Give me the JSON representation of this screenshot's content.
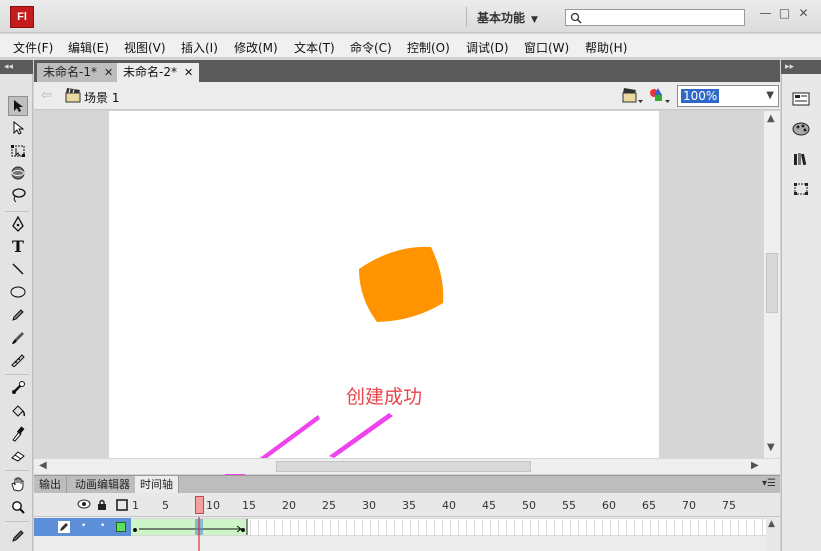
{
  "app": {
    "logo": "Fl",
    "workspace": "基本功能",
    "search_placeholder": ""
  },
  "window_buttons": [
    "—",
    "□",
    "✕"
  ],
  "menu": [
    "文件(F)",
    "编辑(E)",
    "视图(V)",
    "插入(I)",
    "修改(M)",
    "文本(T)",
    "命令(C)",
    "控制(O)",
    "调试(D)",
    "窗口(W)",
    "帮助(H)"
  ],
  "doc_tabs": [
    {
      "label": "未命名-1*",
      "active": false
    },
    {
      "label": "未命名-2*",
      "active": true
    }
  ],
  "scene": {
    "label": "场景 1"
  },
  "zoom": "100%",
  "annotation": "创建成功",
  "panel_tabs": [
    {
      "label": "输出",
      "active": false
    },
    {
      "label": "动画编辑器",
      "active": false
    },
    {
      "label": "时间轴",
      "active": true
    }
  ],
  "timeline": {
    "frame_numbers": [
      "1",
      "5",
      "10",
      "15",
      "20",
      "25",
      "30",
      "35",
      "40",
      "45",
      "50",
      "55",
      "60",
      "65",
      "70",
      "75"
    ],
    "current_frame": 9,
    "tween_start": 1,
    "tween_end": 15
  },
  "colors": {
    "shape_fill": "#ff9400",
    "tween_fill": "#cdf5c8",
    "annotation": "#e8454a",
    "arrow": "#ee44ee",
    "selection": "#3068c8"
  },
  "tools": [
    "selection-tool-icon",
    "subselection-tool-icon",
    "free-transform-tool-icon",
    "3d-rotation-tool-icon",
    "lasso-tool-icon",
    "pen-tool-icon",
    "text-tool-icon",
    "line-tool-icon",
    "oval-tool-icon",
    "pencil-tool-icon",
    "brush-tool-icon",
    "deco-tool-icon",
    "bone-tool-icon",
    "paint-bucket-tool-icon",
    "eyedropper-tool-icon",
    "eraser-tool-icon",
    "hand-tool-icon",
    "zoom-tool-icon",
    "stroke-color-icon"
  ],
  "right_panel_icons": [
    "properties-icon",
    "color-icon",
    "library-icon",
    "align-icon"
  ]
}
